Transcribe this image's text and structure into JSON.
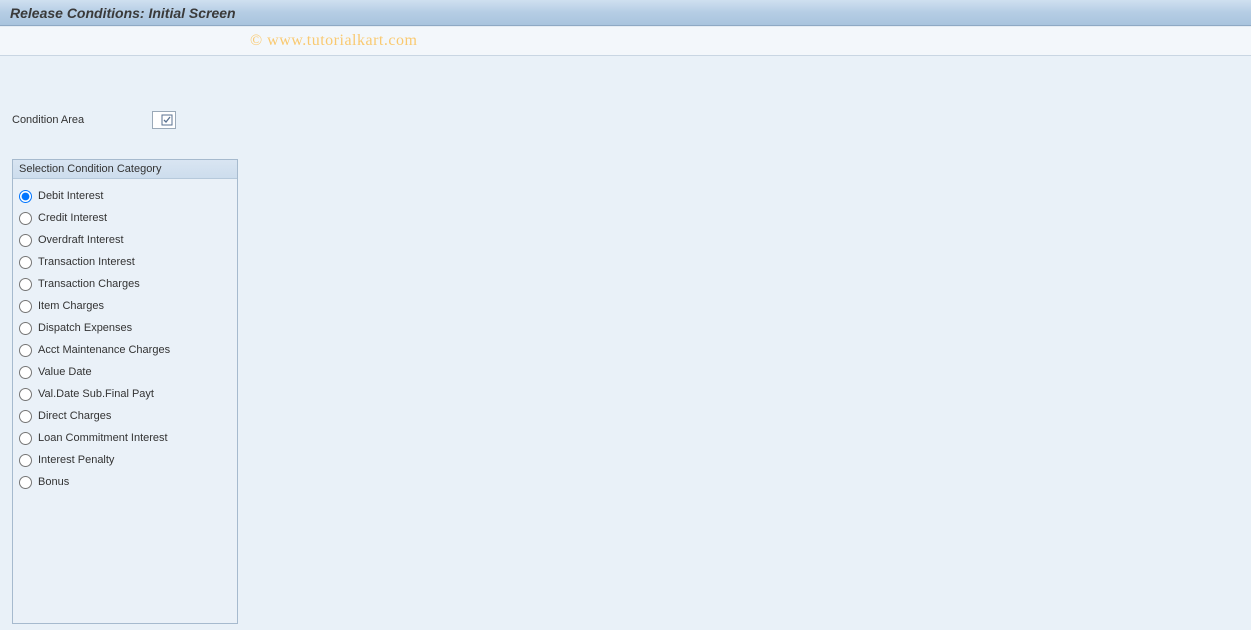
{
  "titlebar": {
    "title": "Release Conditions: Initial Screen"
  },
  "watermark": {
    "text": "© www.tutorialkart.com"
  },
  "form": {
    "condition_area": {
      "label": "Condition Area",
      "value": ""
    }
  },
  "groupbox": {
    "header": "Selection Condition Category",
    "selected_index": 0,
    "options": [
      {
        "label": "Debit Interest"
      },
      {
        "label": "Credit Interest"
      },
      {
        "label": "Overdraft Interest"
      },
      {
        "label": "Transaction Interest"
      },
      {
        "label": "Transaction Charges"
      },
      {
        "label": "Item Charges"
      },
      {
        "label": "Dispatch Expenses"
      },
      {
        "label": "Acct Maintenance Charges"
      },
      {
        "label": "Value Date"
      },
      {
        "label": "Val.Date Sub.Final Payt"
      },
      {
        "label": "Direct Charges"
      },
      {
        "label": "Loan Commitment Interest"
      },
      {
        "label": "Interest Penalty"
      },
      {
        "label": "Bonus"
      }
    ]
  }
}
